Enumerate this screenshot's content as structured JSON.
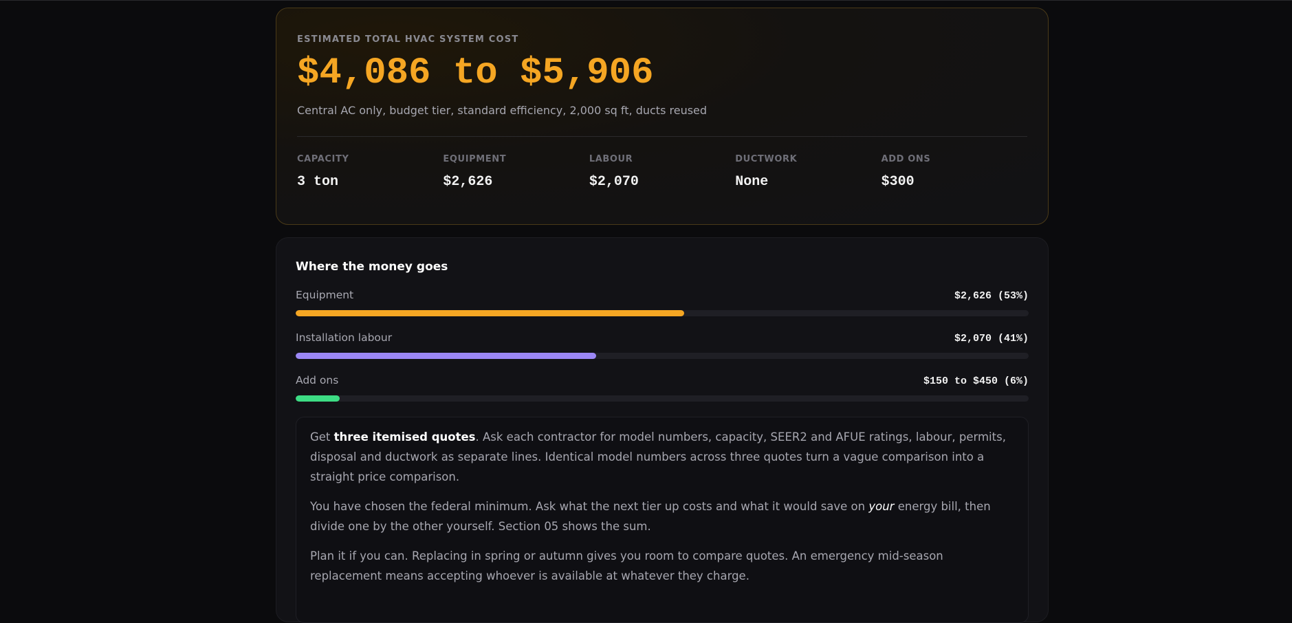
{
  "cost": {
    "eyebrow": "ESTIMATED TOTAL HVAC SYSTEM COST",
    "range": "$4,086 to $5,906",
    "summary": "Central AC only, budget tier, standard efficiency, 2,000 sq ft, ducts reused",
    "stats": [
      {
        "label": "CAPACITY",
        "value": "3 ton"
      },
      {
        "label": "EQUIPMENT",
        "value": "$2,626"
      },
      {
        "label": "LABOUR",
        "value": "$2,070"
      },
      {
        "label": "DUCTWORK",
        "value": "None"
      },
      {
        "label": "ADD ONS",
        "value": "$300"
      }
    ]
  },
  "breakdown": {
    "title": "Where the money goes",
    "rows": [
      {
        "label": "Equipment",
        "amount": "$2,626 (53%)",
        "fraction": 0.53,
        "color": "#f5a623"
      },
      {
        "label": "Installation labour",
        "amount": "$2,070 (41%)",
        "fraction": 0.41,
        "color": "#9b87f5"
      },
      {
        "label": "Add ons",
        "amount": "$150 to $450 (6%)",
        "fraction": 0.06,
        "color": "#3ddc84"
      }
    ]
  },
  "tips": {
    "p1_pre": "Get ",
    "p1_bold": "three itemised quotes",
    "p1_post": ". Ask each contractor for model numbers, capacity, SEER2 and AFUE ratings, labour, permits, disposal and ductwork as separate lines. Identical model numbers across three quotes turn a vague comparison into a straight price comparison.",
    "p2_pre": "You have chosen the federal minimum. Ask what the next tier up costs and what it would save on ",
    "p2_em": "your",
    "p2_post": " energy bill, then divide one by the other yourself. Section 05 shows the sum.",
    "p3": "Plan it if you can. Replacing in spring or autumn gives you room to compare quotes. An emergency mid-season replacement means accepting whoever is available at whatever they charge."
  }
}
